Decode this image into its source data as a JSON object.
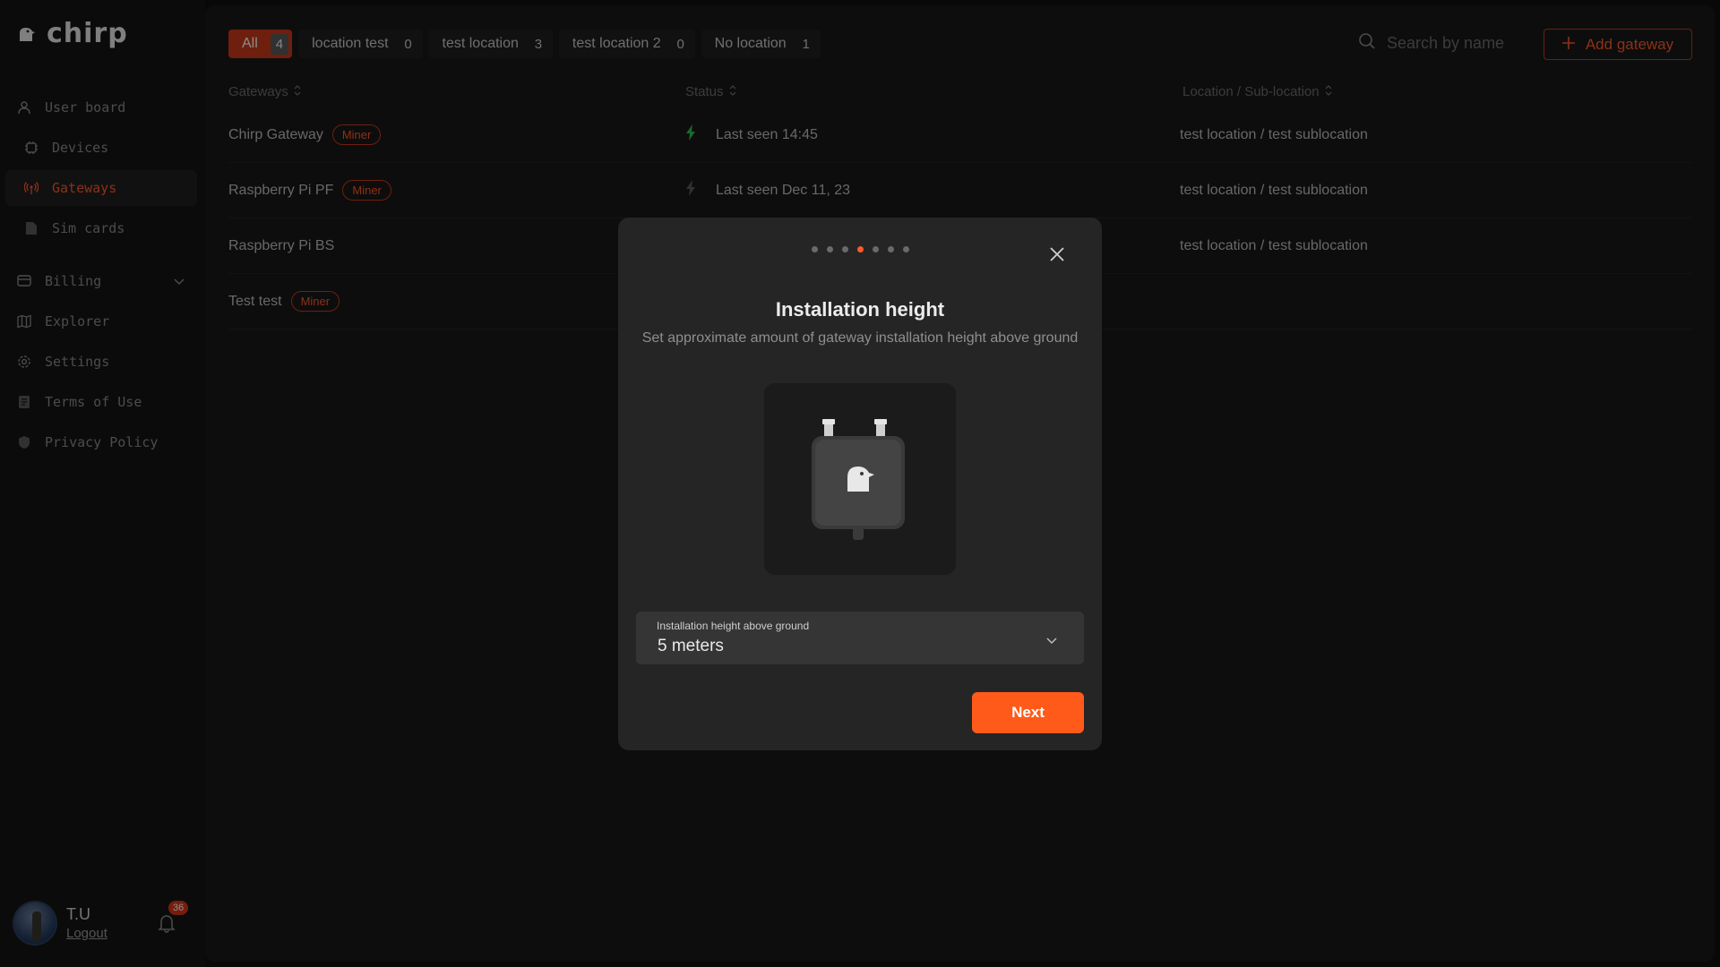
{
  "app": {
    "logo_text": "chirp"
  },
  "sidebar": {
    "items": [
      {
        "label": "User board",
        "icon": "user-icon"
      },
      {
        "label": "Devices",
        "icon": "chip-icon"
      },
      {
        "label": "Gateways",
        "icon": "antenna-icon",
        "active": true
      },
      {
        "label": "Sim cards",
        "icon": "sim-card-icon"
      },
      {
        "label": "Billing",
        "icon": "billing-icon"
      },
      {
        "label": "Explorer",
        "icon": "map-icon"
      },
      {
        "label": "Settings",
        "icon": "gear-icon"
      },
      {
        "label": "Terms of Use",
        "icon": "document-icon"
      },
      {
        "label": "Privacy Policy",
        "icon": "shield-icon"
      }
    ],
    "user": {
      "name": "T.U",
      "logout": "Logout",
      "notifications": "36"
    }
  },
  "filters": [
    {
      "label": "All",
      "count": "4",
      "active": true
    },
    {
      "label": "location test",
      "count": "0"
    },
    {
      "label": "test location",
      "count": "3"
    },
    {
      "label": "test location 2",
      "count": "0"
    },
    {
      "label": "No location",
      "count": "1"
    }
  ],
  "search": {
    "placeholder": "Search by name"
  },
  "add_button": "Add gateway",
  "table": {
    "headers": [
      "Gateways",
      "Status",
      "Location / Sub-location"
    ],
    "rows": [
      {
        "name": "Chirp Gateway",
        "badge": "Miner",
        "status": "Last seen 14:45",
        "location": "test location / test sublocation"
      },
      {
        "name": "Raspberry Pi PF",
        "badge": "Miner",
        "status": "Last seen Dec 11, 23",
        "location": "test location / test sublocation"
      },
      {
        "name": "Raspberry Pi BS",
        "badge": "",
        "status": "",
        "location": "test location / test sublocation"
      },
      {
        "name": "Test test",
        "badge": "Miner",
        "status": "",
        "location": ""
      }
    ]
  },
  "modal": {
    "steps_total": 7,
    "step_current": 4,
    "title": "Installation height",
    "subtitle": "Set approximate amount of gateway installation height above ground",
    "select_label": "Installation height above ground",
    "select_value": "5 meters",
    "next": "Next"
  },
  "colors": {
    "accent": "#ff5a1a",
    "bg": "#0f0f0f",
    "panel": "#181818",
    "status_online": "#2fbf5a"
  }
}
